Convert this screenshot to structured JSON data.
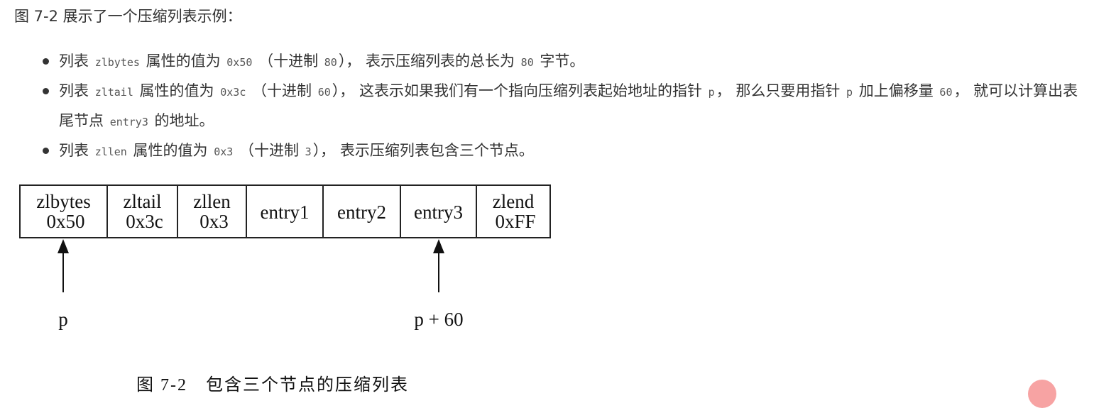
{
  "intro": "图 7-2 展示了一个压缩列表示例：",
  "bullets": [
    {
      "parts": [
        {
          "t": "text",
          "v": "列表 "
        },
        {
          "t": "code",
          "v": "zlbytes"
        },
        {
          "t": "text",
          "v": " 属性的值为 "
        },
        {
          "t": "code",
          "v": "0x50"
        },
        {
          "t": "text",
          "v": " （十进制 "
        },
        {
          "t": "code",
          "v": "80"
        },
        {
          "t": "text",
          "v": "）， 表示压缩列表的总长为 "
        },
        {
          "t": "code",
          "v": "80"
        },
        {
          "t": "text",
          "v": " 字节。"
        }
      ]
    },
    {
      "parts": [
        {
          "t": "text",
          "v": "列表 "
        },
        {
          "t": "code",
          "v": "zltail"
        },
        {
          "t": "text",
          "v": " 属性的值为 "
        },
        {
          "t": "code",
          "v": "0x3c"
        },
        {
          "t": "text",
          "v": " （十进制 "
        },
        {
          "t": "code",
          "v": "60"
        },
        {
          "t": "text",
          "v": "）， 这表示如果我们有一个指向压缩列表起始地址的指针 "
        },
        {
          "t": "code",
          "v": "p"
        },
        {
          "t": "text",
          "v": "， 那么只要用指针 "
        },
        {
          "t": "code",
          "v": "p"
        },
        {
          "t": "text",
          "v": " 加上偏移量 "
        },
        {
          "t": "code",
          "v": "60"
        },
        {
          "t": "text",
          "v": "， 就可以计算出表尾节点 "
        },
        {
          "t": "code",
          "v": "entry3"
        },
        {
          "t": "text",
          "v": " 的地址。"
        }
      ]
    },
    {
      "parts": [
        {
          "t": "text",
          "v": "列表 "
        },
        {
          "t": "code",
          "v": "zllen"
        },
        {
          "t": "text",
          "v": " 属性的值为 "
        },
        {
          "t": "code",
          "v": "0x3"
        },
        {
          "t": "text",
          "v": " （十进制 "
        },
        {
          "t": "code",
          "v": "3"
        },
        {
          "t": "text",
          "v": "）， 表示压缩列表包含三个节点。"
        }
      ]
    }
  ],
  "diagram": {
    "cells": [
      {
        "line1": "zlbytes",
        "line2": "0x50"
      },
      {
        "line1": "zltail",
        "line2": "0x3c"
      },
      {
        "line1": "zllen",
        "line2": "0x3"
      },
      {
        "line1": "entry1",
        "line2": ""
      },
      {
        "line1": "entry2",
        "line2": ""
      },
      {
        "line1": "entry3",
        "line2": ""
      },
      {
        "line1": "zlend",
        "line2": "0xFF"
      }
    ],
    "pointers": [
      {
        "label": "p",
        "target_cell": 0
      },
      {
        "label": "p + 60",
        "target_cell": 5
      }
    ]
  },
  "caption": "图 7-2　包含三个节点的压缩列表"
}
